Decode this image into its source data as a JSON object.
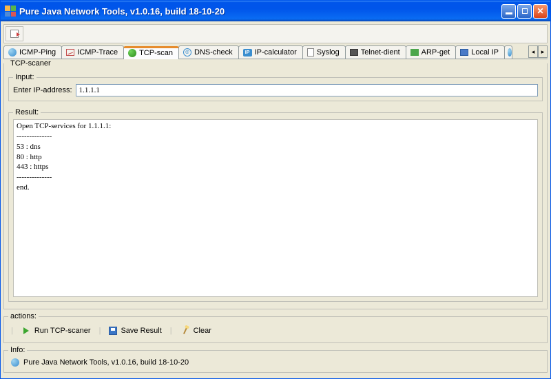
{
  "titlebar": {
    "text": "Pure Java Network Tools,  v1.0.16, build 18-10-20"
  },
  "tabs": [
    {
      "label": "ICMP-Ping",
      "active": false,
      "icon": "globe"
    },
    {
      "label": "ICMP-Trace",
      "active": false,
      "icon": "trace"
    },
    {
      "label": "TCP-scan",
      "active": true,
      "icon": "green"
    },
    {
      "label": "DNS-check",
      "active": false,
      "icon": "dns"
    },
    {
      "label": "IP-calculator",
      "active": false,
      "icon": "ip"
    },
    {
      "label": "Syslog",
      "active": false,
      "icon": "page"
    },
    {
      "label": "Telnet-dient",
      "active": false,
      "icon": "telnet"
    },
    {
      "label": "ARP-get",
      "active": false,
      "icon": "arp"
    },
    {
      "label": "Local IP",
      "active": false,
      "icon": "lip"
    }
  ],
  "panel": {
    "title": "TCP-scaner",
    "input_legend": "Input:",
    "input_label": "Enter IP-address:",
    "input_value": "1.1.1.1",
    "result_legend": "Result:",
    "result_text": "Open TCP-services for 1.1.1.1:\n--------------\n53 : dns\n80 : http\n443 : https\n--------------\nend."
  },
  "actions": {
    "legend": "actions:",
    "run": "Run TCP-scaner",
    "save": "Save Result",
    "clear": "Clear"
  },
  "info": {
    "legend": "Info:",
    "text": "Pure Java Network Tools,  v1.0.16, build 18-10-20"
  }
}
